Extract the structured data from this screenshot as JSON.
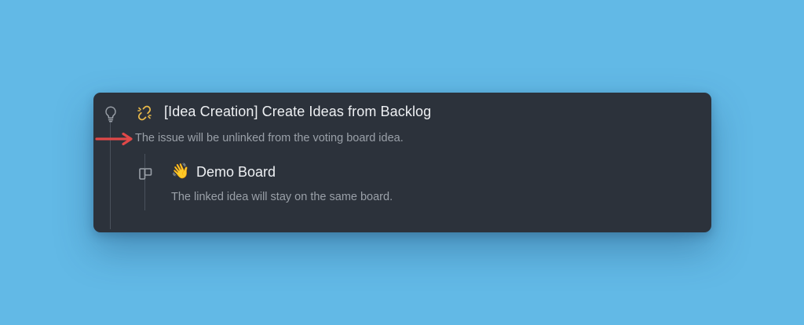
{
  "issue": {
    "title": "[Idea Creation] Create Ideas from Backlog",
    "description": "The issue will be unlinked from the voting board idea.",
    "icon": "unlink-icon",
    "icon_color": "#e8b94a"
  },
  "board": {
    "emoji": "👋",
    "name": "Demo Board",
    "description": "The linked idea will stay on the same board.",
    "icon": "board-icon"
  },
  "colors": {
    "background": "#62b9e6",
    "card": "#2c323b",
    "annotation_arrow": "#e04848"
  }
}
